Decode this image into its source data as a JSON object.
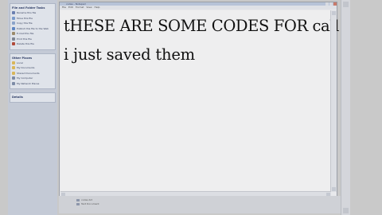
{
  "task_pane": {
    "panels": [
      {
        "title": "File and Folder Tasks",
        "items": [
          {
            "label": "Rename this file",
            "icon": "rename-icon",
            "color": "#6a7fb0"
          },
          {
            "label": "Move this file",
            "icon": "move-icon",
            "color": "#7a9acb"
          },
          {
            "label": "Copy this file",
            "icon": "copy-icon",
            "color": "#8aa3c9"
          },
          {
            "label": "Publish this file to the Web",
            "icon": "web-icon",
            "color": "#5f86c2"
          },
          {
            "label": "E-mail this file",
            "icon": "mail-icon",
            "color": "#9b8a6a"
          },
          {
            "label": "Print this file",
            "icon": "print-icon",
            "color": "#7d8594"
          },
          {
            "label": "Delete this file",
            "icon": "delete-icon",
            "color": "#b04a3a"
          }
        ]
      },
      {
        "title": "Other Places",
        "items": [
          {
            "label": "Local",
            "icon": "folder-icon",
            "color": "#d8b65a"
          },
          {
            "label": "My Documents",
            "icon": "folder-icon",
            "color": "#d8b65a"
          },
          {
            "label": "Shared Documents",
            "icon": "folder-icon",
            "color": "#d8b65a"
          },
          {
            "label": "My Computer",
            "icon": "computer-icon",
            "color": "#7d8ba6"
          },
          {
            "label": "My Network Places",
            "icon": "network-icon",
            "color": "#7d8ba6"
          }
        ]
      },
      {
        "title": "Details",
        "items": []
      }
    ]
  },
  "window": {
    "title": "codes - Notepad",
    "menu": [
      "File",
      "Edit",
      "Format",
      "View",
      "Help"
    ]
  },
  "editor": {
    "line1": "tHESE ARE SOME CODES FOR call",
    "line2": "i just saved them"
  },
  "status_items": [
    {
      "label": "codes.txt"
    },
    {
      "label": "Text Document"
    }
  ],
  "colors": {
    "editor_background": "#eeeeef",
    "task_pane": "#c4cad6",
    "text": "#111111"
  }
}
